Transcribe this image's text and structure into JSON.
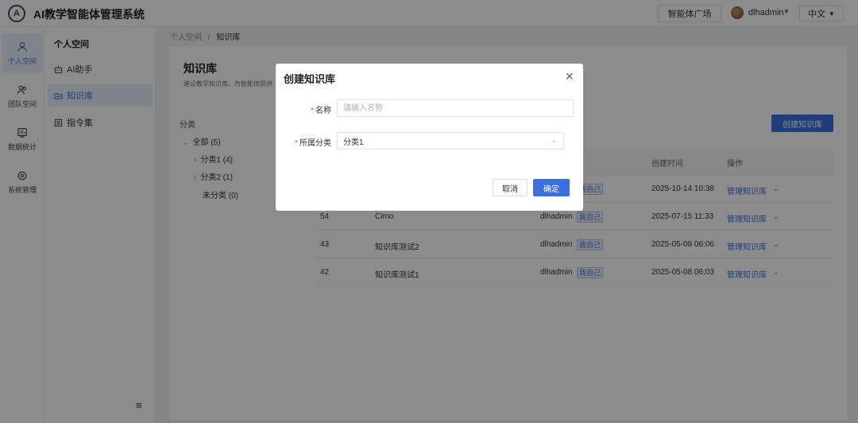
{
  "header": {
    "logo_letter": "A",
    "app_title": "AI教学智能体管理系统",
    "market_label": "智能体广场",
    "user_name": "dlhadmin",
    "language": "中文"
  },
  "rail": {
    "items": [
      {
        "label": "个人空间",
        "icon": "user-icon",
        "active": true
      },
      {
        "label": "团队空间",
        "icon": "team-icon",
        "active": false
      },
      {
        "label": "数据统计",
        "icon": "chart-icon",
        "active": false
      },
      {
        "label": "系统管理",
        "icon": "gear-icon",
        "active": false
      }
    ]
  },
  "subnav": {
    "title": "个人空间",
    "items": [
      {
        "label": "AI助手",
        "icon": "robot-icon",
        "active": false
      },
      {
        "label": "知识库",
        "icon": "folder-icon",
        "active": true
      },
      {
        "label": "指令集",
        "icon": "list-icon",
        "active": false
      }
    ]
  },
  "breadcrumb": {
    "root": "个人空间",
    "separator": "/",
    "current": "知识库"
  },
  "main": {
    "title": "知识库",
    "description": "建设教学知识库，为智能体提供",
    "create_label": "创建知识库",
    "category_label": "分类",
    "tree": [
      {
        "label": "全部 (5)",
        "caret": "⌄"
      },
      {
        "label": "分类1 (4)",
        "caret": "›"
      },
      {
        "label": "分类2 (1)",
        "caret": "›"
      },
      {
        "label": "未分类 (0)",
        "caret": ""
      }
    ]
  },
  "table": {
    "headers": {
      "created": "创建时间",
      "ops": "操作"
    },
    "rows": [
      {
        "id": "",
        "name": "",
        "owner": "",
        "tag": "我自己",
        "created": "2025-10-14 10:38",
        "op": "管理知识库"
      },
      {
        "id": "54",
        "name": "Cimo",
        "owner": "dlhadmin",
        "tag": "我自己",
        "created": "2025-07-15 11:33",
        "op": "管理知识库"
      },
      {
        "id": "43",
        "name": "知识库测试2",
        "owner": "dlhadmin",
        "tag": "我自己",
        "created": "2025-05-08 06:06",
        "op": "管理知识库"
      },
      {
        "id": "42",
        "name": "知识库测试1",
        "owner": "dlhadmin",
        "tag": "我自己",
        "created": "2025-05-08 06:03",
        "op": "管理知识库"
      }
    ]
  },
  "modal": {
    "title": "创建知识库",
    "name_label": "名称",
    "name_placeholder": "请输入名称",
    "name_value": "",
    "category_label": "所属分类",
    "category_value": "分类1",
    "cancel_label": "取消",
    "ok_label": "确定",
    "required_mark": "*"
  },
  "colors": {
    "primary": "#3a6fe0",
    "required": "#e5484d"
  }
}
